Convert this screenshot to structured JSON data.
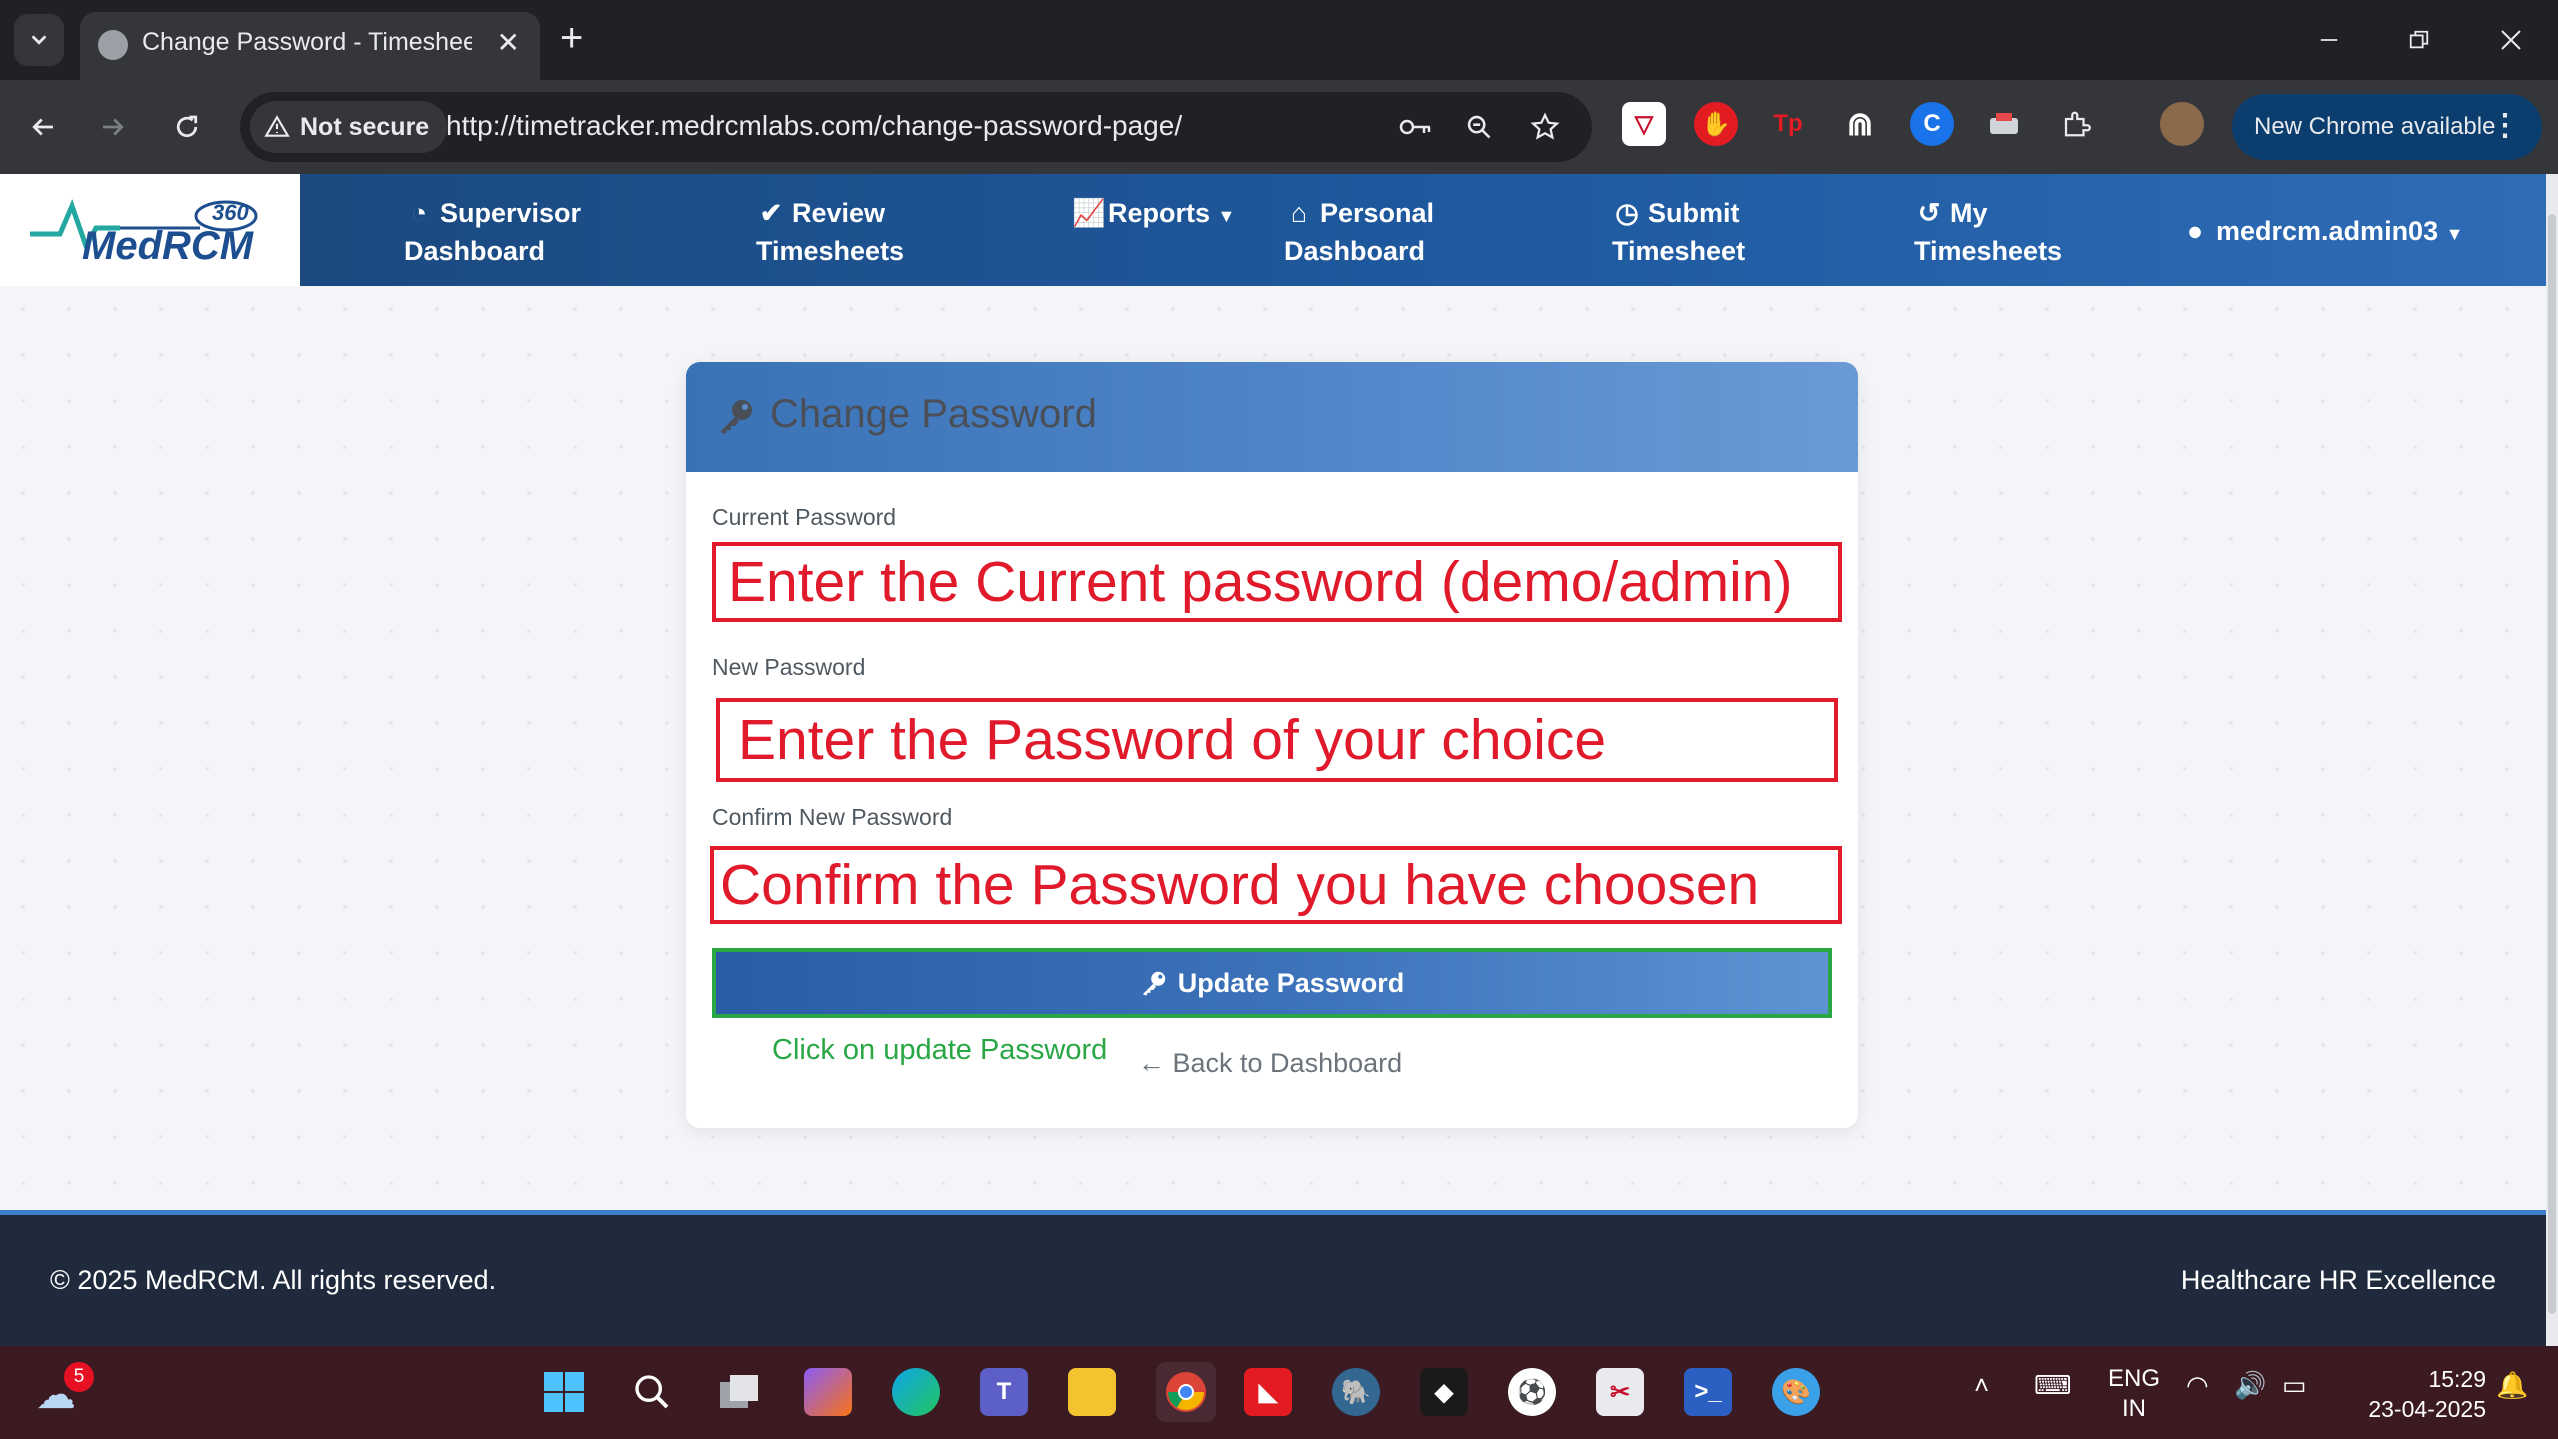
{
  "browser": {
    "tab_title": "Change Password - Timesheet M",
    "new_tab_symbol": "+",
    "security_label": "Not secure",
    "url": "http://timetracker.medrcmlabs.com/change-password-page/",
    "update_label": "New Chrome available"
  },
  "site": {
    "logo_text": "MedRCM",
    "logo_badge": "360",
    "nav": [
      {
        "line1": "Supervisor",
        "line2": "Dashboard"
      },
      {
        "line1": "Review",
        "line2": "Timesheets"
      },
      {
        "line1": "Reports",
        "line2": ""
      },
      {
        "line1": "Personal",
        "line2": "Dashboard"
      },
      {
        "line1": "Submit",
        "line2": "Timesheet"
      },
      {
        "line1": "My",
        "line2": "Timesheets"
      }
    ],
    "user": "medrcm.admin03"
  },
  "form": {
    "title": "Change Password",
    "current_label": "Current Password",
    "current_value": "Enter the Current password (demo/admin)",
    "new_label": "New Password",
    "new_value": "Enter the Password of your choice",
    "confirm_label": "Confirm New Password",
    "confirm_value": "Confirm the Password you have choosen",
    "submit_label": "Update Password",
    "hint": "Click on update Password",
    "back_label": "Back to Dashboard"
  },
  "footer": {
    "copyright": "© 2025 MedRCM. All rights reserved.",
    "tagline": "Healthcare HR Excellence"
  },
  "taskbar": {
    "weather_badge": "5",
    "lang_line1": "ENG",
    "lang_line2": "IN",
    "time": "15:29",
    "date": "23-04-2025"
  },
  "colors": {
    "accent_blue": "#1f5aa0",
    "annotation_red": "#e0192b",
    "annotation_green": "#2aa745"
  }
}
